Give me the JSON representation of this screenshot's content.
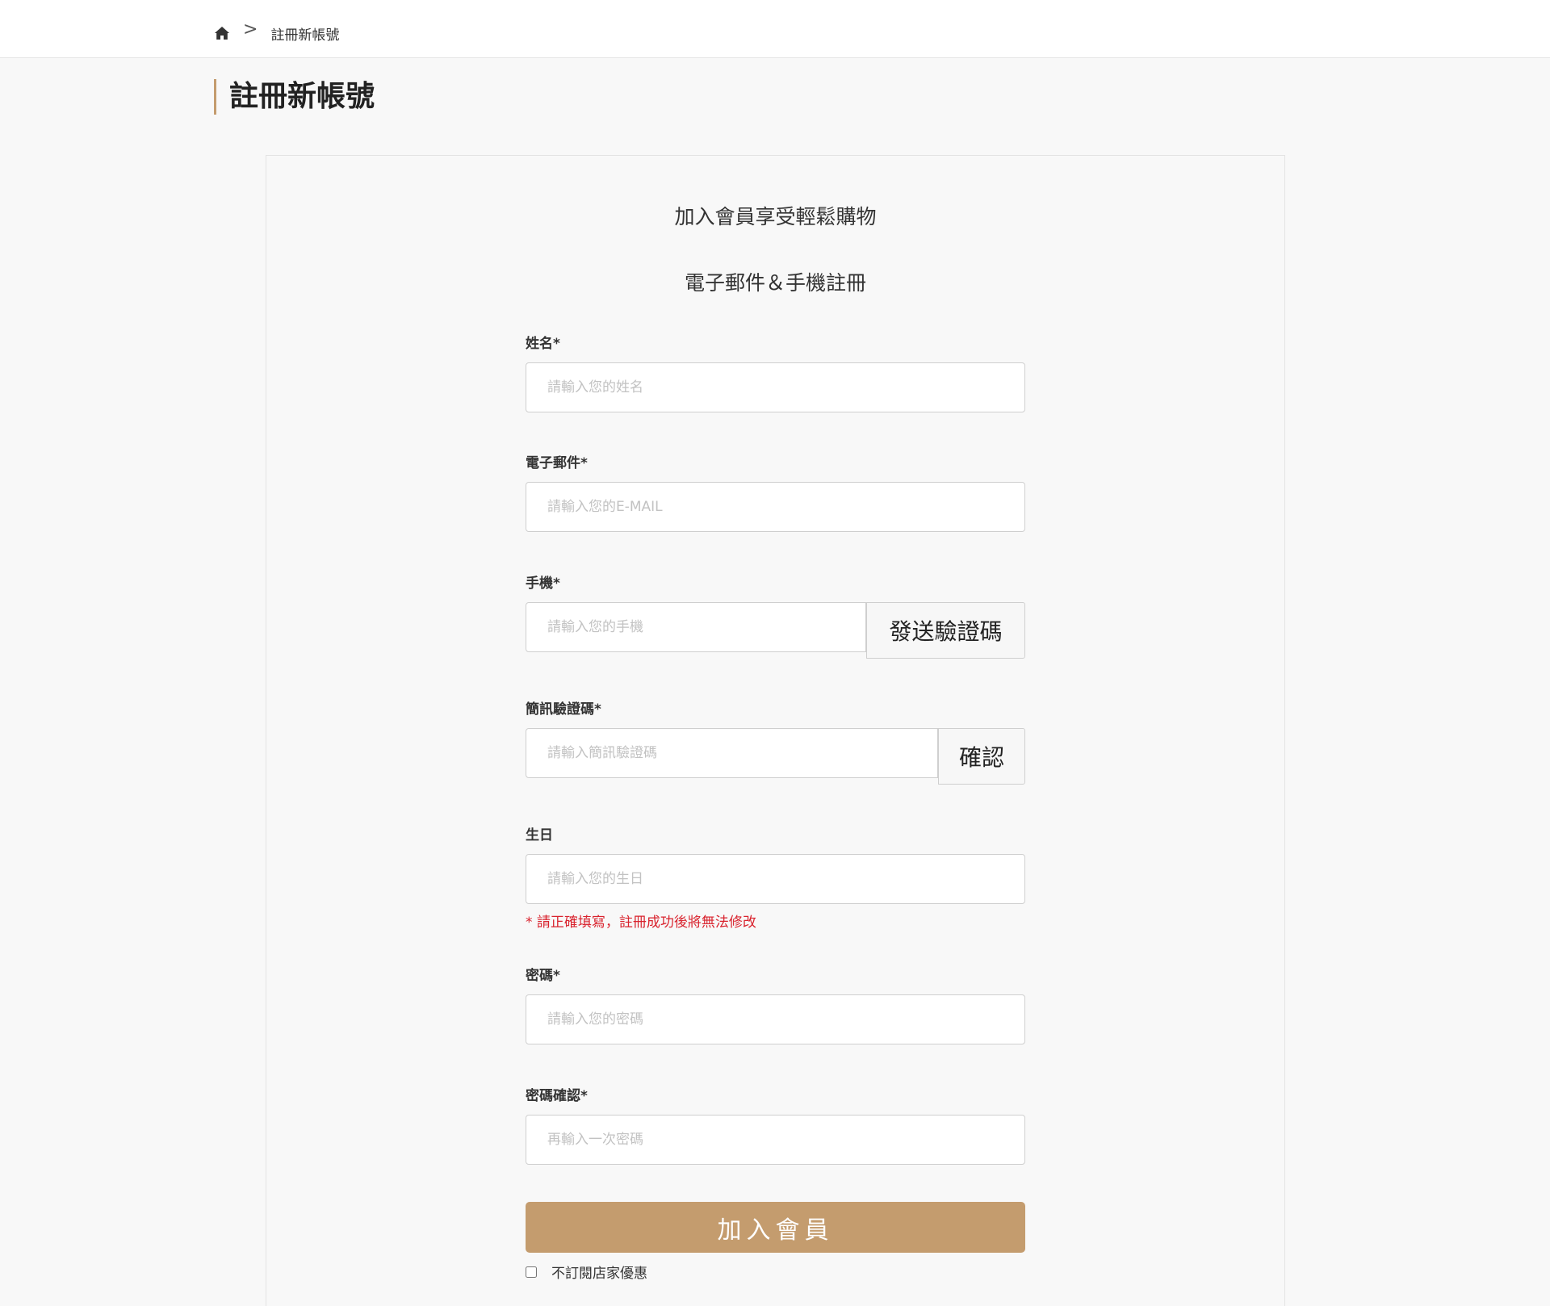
{
  "breadcrumb": {
    "home_icon": "home-icon",
    "separator": ">",
    "current": "註冊新帳號"
  },
  "page_title": "註冊新帳號",
  "form": {
    "heading": "加入會員享受輕鬆購物",
    "subheading": "電子郵件＆手機註冊",
    "name": {
      "label": "姓名*",
      "placeholder": "請輸入您的姓名"
    },
    "email": {
      "label": "電子郵件*",
      "placeholder": "請輸入您的E-MAIL"
    },
    "phone": {
      "label": "手機*",
      "placeholder": "請輸入您的手機",
      "button": "發送驗證碼"
    },
    "sms_code": {
      "label": "簡訊驗證碼*",
      "placeholder": "請輸入簡訊驗證碼",
      "button": "確認"
    },
    "birthday": {
      "label": "生日",
      "placeholder": "請輸入您的生日",
      "note": "* 請正確填寫，註冊成功後將無法修改"
    },
    "password": {
      "label": "密碼*",
      "placeholder": "請輸入您的密碼"
    },
    "password_confirm": {
      "label": "密碼確認*",
      "placeholder": "再輸入一次密碼"
    },
    "submit": "加入會員",
    "optout": "不訂閱店家優惠"
  },
  "colors": {
    "accent": "#c49c6e",
    "error": "#d9232e",
    "background": "#f8f8f8"
  }
}
